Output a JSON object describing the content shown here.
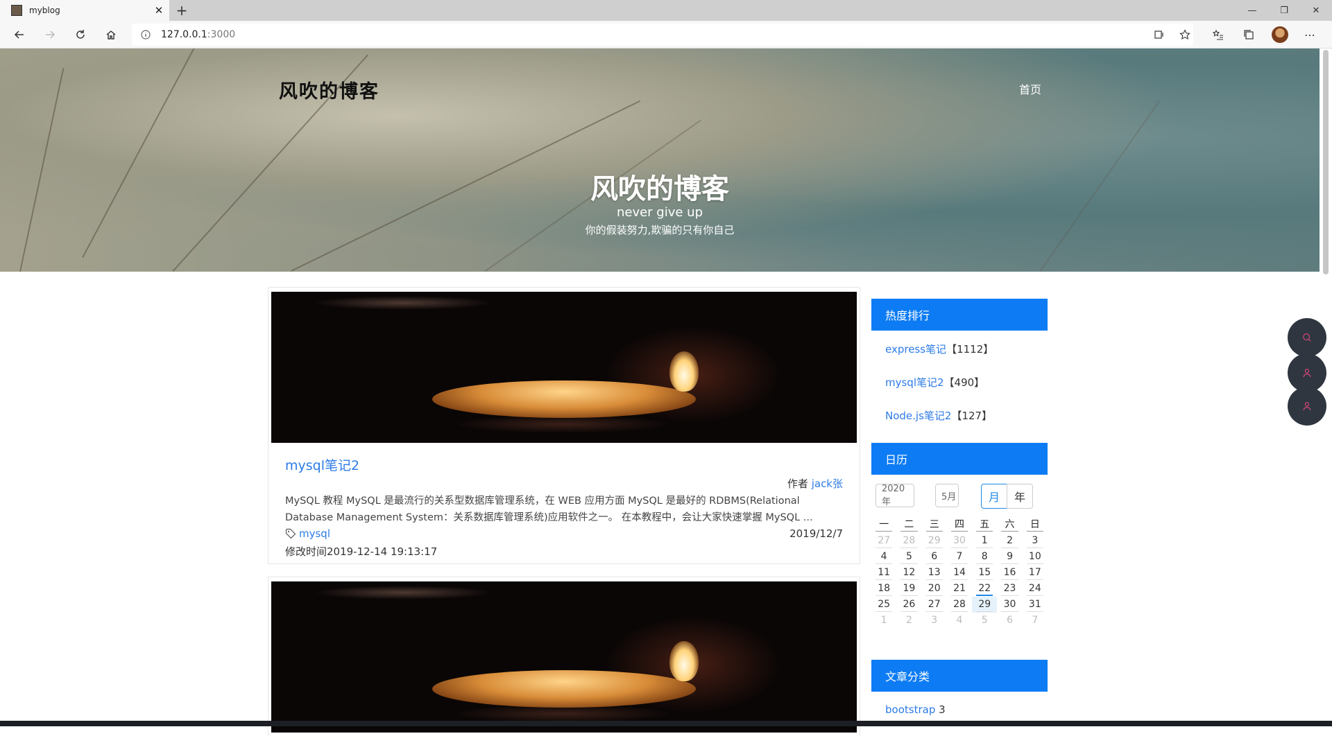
{
  "browser": {
    "tab_title": "myblog",
    "url_host": "127.0.0.1",
    "url_port": ":3000"
  },
  "header": {
    "brand": "风吹的博客",
    "nav_home": "首页",
    "hero_title": "风吹的博客",
    "hero_subtitle": "never give up",
    "hero_motto": "你的假装努力,欺骗的只有你自己"
  },
  "posts": [
    {
      "title": "mysql笔记2",
      "author_label": "作者",
      "author": "jack张",
      "excerpt": "MySQL 教程 MySQL 是最流行的关系型数据库管理系统，在 WEB 应用方面 MySQL 是最好的 RDBMS(Relational Database Management System：关系数据库管理系统)应用软件之一。 在本教程中，会让大家快速掌握 MySQL ...",
      "tag": "mysql",
      "date": "2019/12/7",
      "modified": "修改时间2019-12-14 19:13:17"
    }
  ],
  "sidebar": {
    "hot_title": "热度排行",
    "hot_items": [
      {
        "name": "express笔记",
        "count": "【1112】"
      },
      {
        "name": "mysql笔记2",
        "count": "【490】"
      },
      {
        "name": "Node.js笔记2",
        "count": "【127】"
      }
    ],
    "calendar_title": "日历",
    "calendar": {
      "year": "2020年",
      "month": "5月",
      "mode_month": "月",
      "mode_year": "年",
      "weekdays": [
        "一",
        "二",
        "三",
        "四",
        "五",
        "六",
        "日"
      ],
      "weeks": [
        [
          "27",
          "28",
          "29",
          "30",
          "1",
          "2",
          "3"
        ],
        [
          "4",
          "5",
          "6",
          "7",
          "8",
          "9",
          "10"
        ],
        [
          "11",
          "12",
          "13",
          "14",
          "15",
          "16",
          "17"
        ],
        [
          "18",
          "19",
          "20",
          "21",
          "22",
          "23",
          "24"
        ],
        [
          "25",
          "26",
          "27",
          "28",
          "29",
          "30",
          "31"
        ],
        [
          "1",
          "2",
          "3",
          "4",
          "5",
          "6",
          "7"
        ]
      ]
    },
    "category_title": "文章分类",
    "categories": [
      {
        "name": "bootstrap",
        "count": "3"
      }
    ]
  },
  "colors": {
    "accent": "#0d7cf4",
    "link": "#2c7be5",
    "fab_bg": "#2f3640",
    "fab_icon": "#e0477a"
  }
}
